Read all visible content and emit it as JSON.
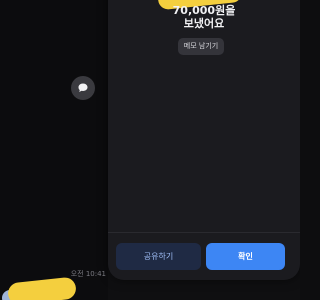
{
  "transfer": {
    "amount": "70,000원을",
    "sent_label": "보냈어요",
    "memo_button": "메모 남기기"
  },
  "chat": {
    "timestamp": "오전 10:41",
    "icon": "chat-bubble-icon"
  },
  "actions": {
    "share_label": "공유하기",
    "confirm_label": "확인"
  },
  "colors": {
    "accent": "#3d86f4",
    "highlight": "#f4cf3e",
    "sheet": "#1b1b1f"
  }
}
